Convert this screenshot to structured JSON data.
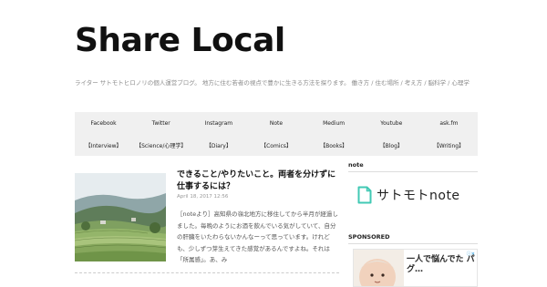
{
  "site": {
    "title": "Share Local",
    "tagline": "ライター サトモトヒロノリの個人運営ブログ。 地方に住む若者の視点で豊かに生きる方法を探ります。 働き方 / 住む場所 / 考え方 / 脳科学 / 心理学"
  },
  "nav": {
    "row1": [
      "Facebook",
      "Twitter",
      "Instagram",
      "Note",
      "Medium",
      "Youtube",
      "ask.fm"
    ],
    "row2": [
      "【Interview】",
      "【Science/心理学】",
      "【Diary】",
      "【Comics】",
      "【Books】",
      "【Blog】",
      "【Writing】"
    ]
  },
  "post": {
    "title": "できること/やりたいこと。両者を分けずに仕事するには？",
    "date": "April 18, 2017 12:56",
    "excerpt": "［noteより］高知県の嶺北地方に移住してから半月が経過しました。毎晩のようにお酒を飲んでいる気がしていて、自分の肝臓をいたわらないかんなーって思っています。けれども、少しずつ芽生えてきた感覚があるんですよね。それは「所属感」。あ、み"
  },
  "sidebar": {
    "note_heading": "note",
    "note_logo_text": "サトモトnote",
    "sponsored_heading": "SPONSORED",
    "ad_text": "一人で悩んでた パグ…",
    "ad_badge": "ⓘ✕"
  },
  "colors": {
    "nav_bg": "#f0f0f0",
    "title": "#111111",
    "note_icon": "#41c9b4"
  }
}
